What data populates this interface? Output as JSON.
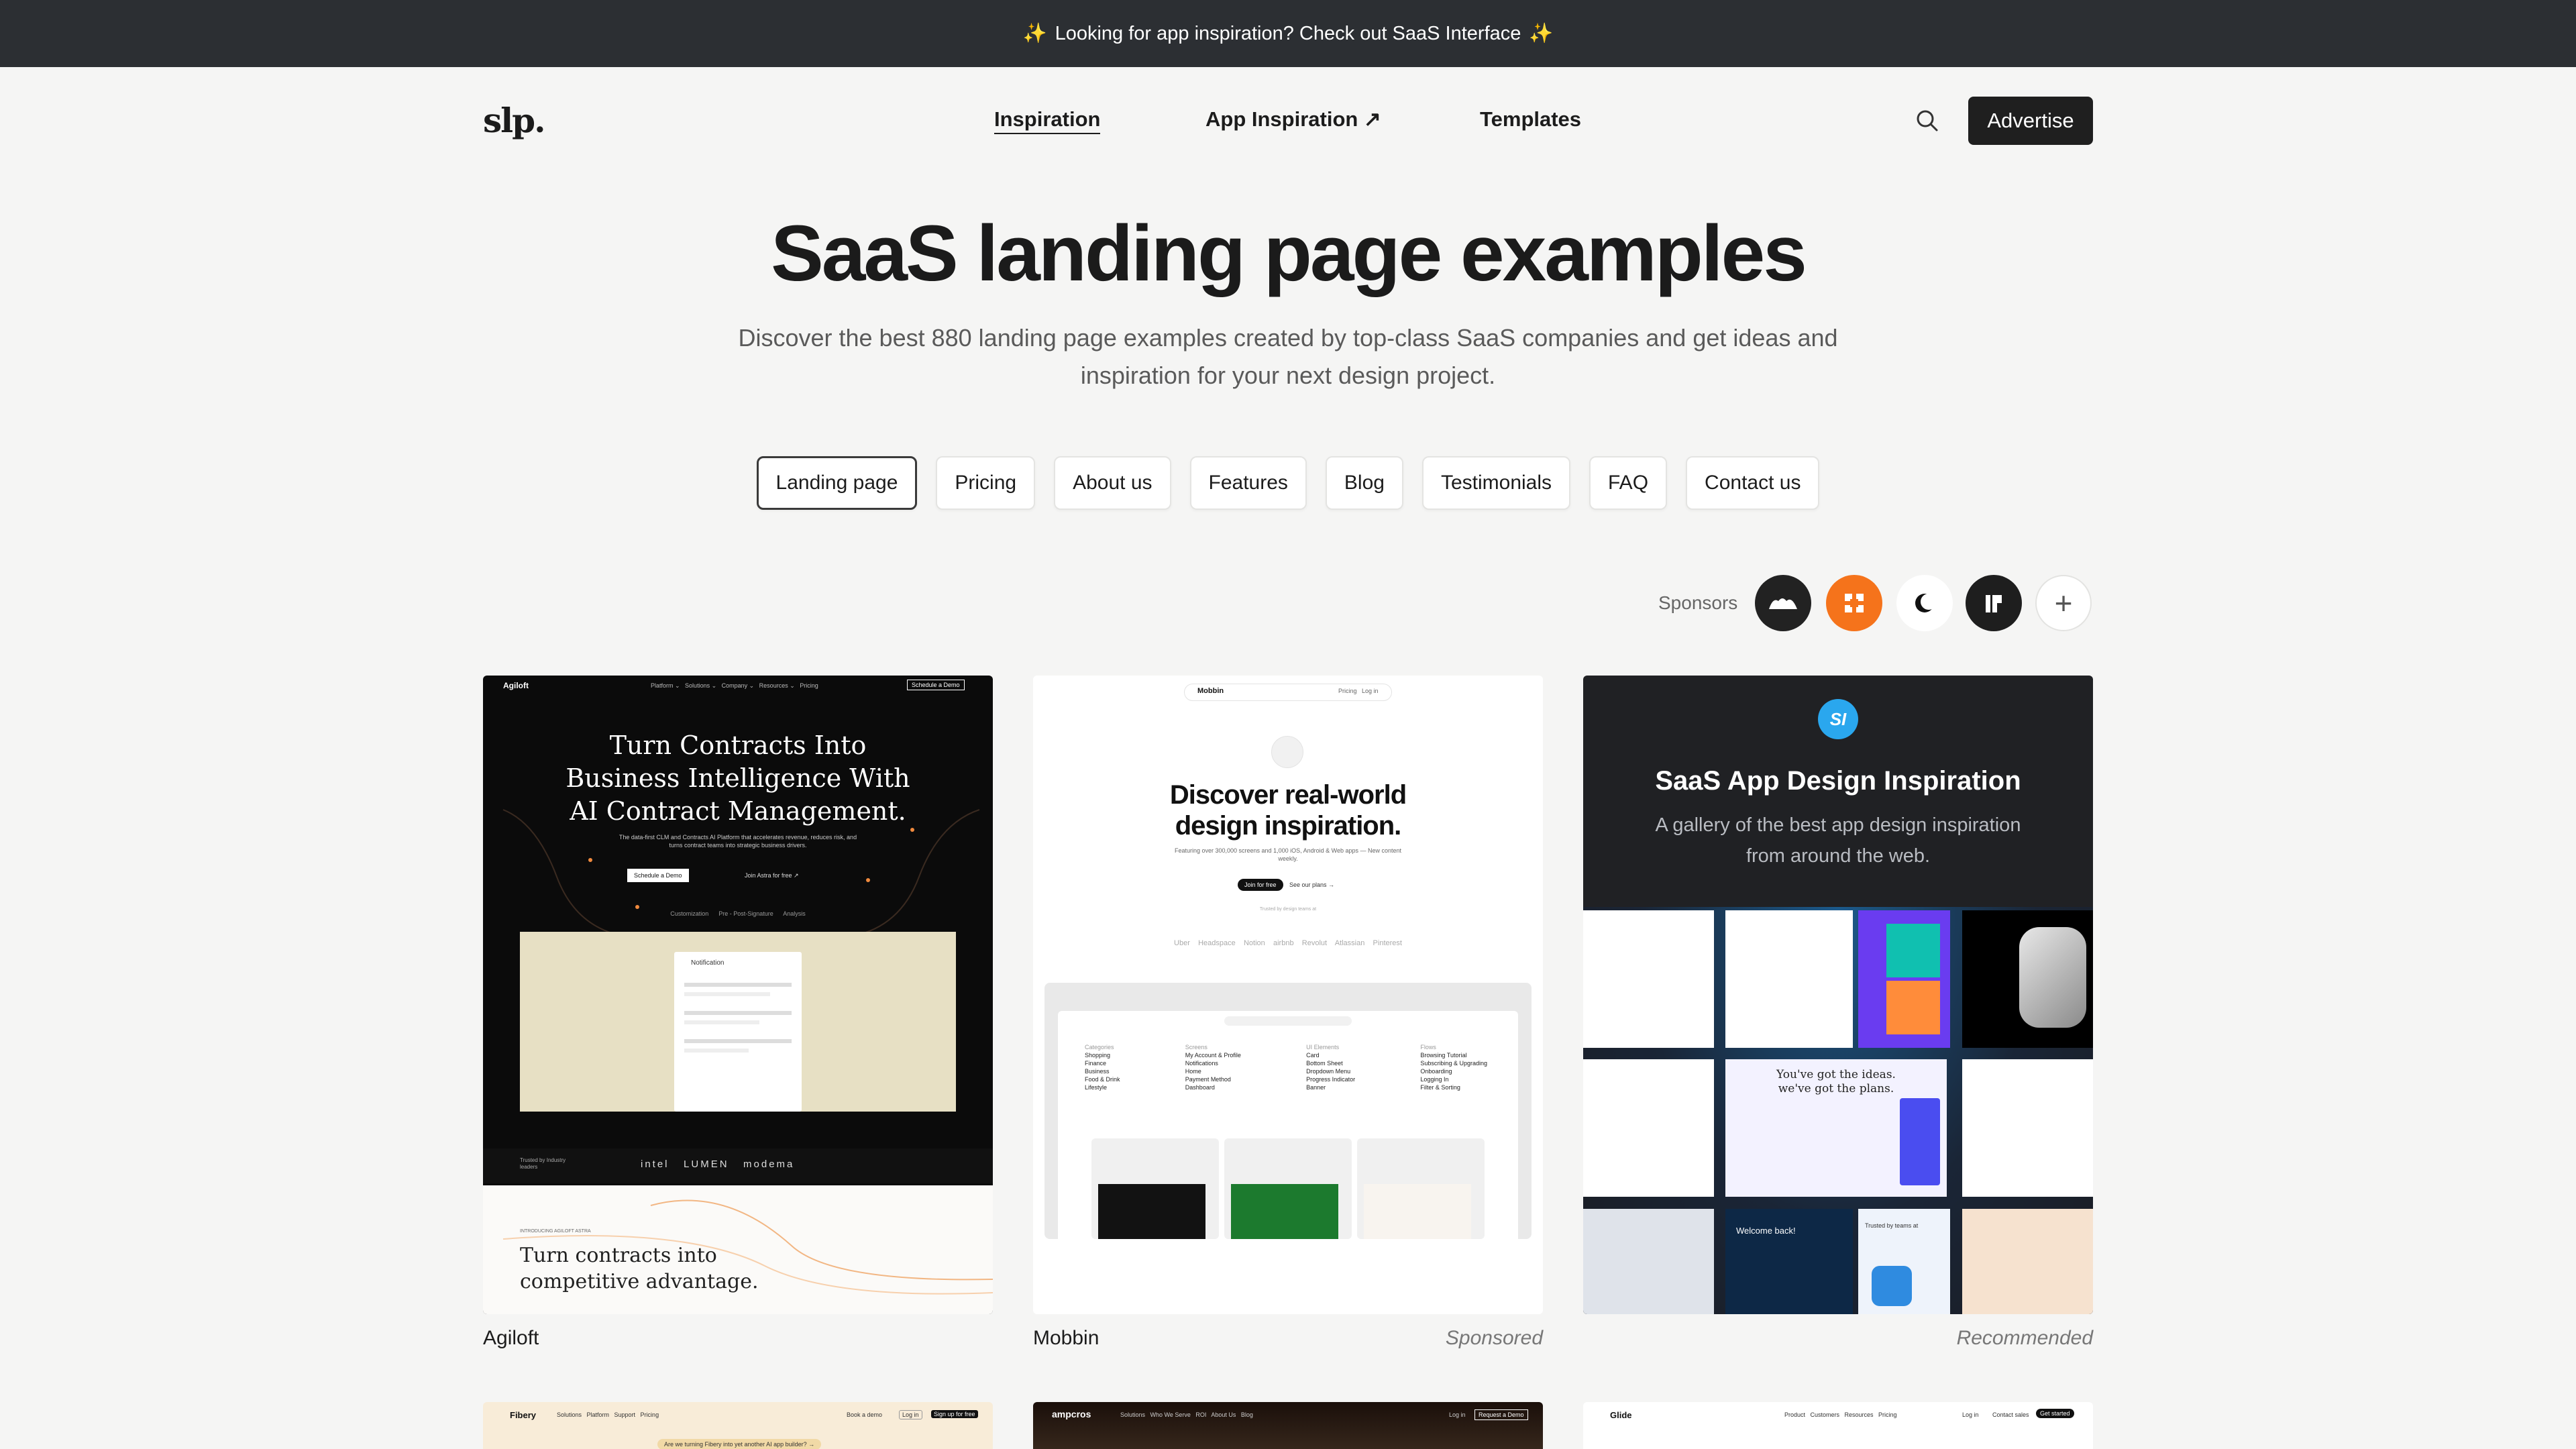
{
  "banner": {
    "text": "Looking for app inspiration? Check out SaaS Interface",
    "spark": "✨"
  },
  "header": {
    "logo": "slp.",
    "nav": [
      {
        "label": "Inspiration",
        "active": true
      },
      {
        "label": "App Inspiration ↗",
        "active": false
      },
      {
        "label": "Templates",
        "active": false
      }
    ],
    "search_icon": "search-icon",
    "advertise_label": "Advertise"
  },
  "hero": {
    "title": "SaaS landing page examples",
    "subtitle": "Discover the best 880 landing page examples created by top-class SaaS companies and get ideas and inspiration for your next design project."
  },
  "filters": [
    "Landing page",
    "Pricing",
    "About us",
    "Features",
    "Blog",
    "Testimonials",
    "FAQ",
    "Contact us"
  ],
  "active_filter": "Landing page",
  "sponsors": {
    "label": "Sponsors",
    "add_symbol": "+"
  },
  "cards": [
    {
      "name": "Agiloft",
      "tag": "",
      "preview": {
        "brand": "Agiloft",
        "nav": "Platform ⌄   Solutions ⌄   Company ⌄   Resources ⌄   Pricing",
        "cta": "Schedule a Demo",
        "headline_1": "Turn Contracts Into",
        "headline_2": "Business Intelligence With",
        "headline_3": "AI Contract Management.",
        "body": "The data-first CLM and Contracts AI Platform that accelerates revenue, reduces risk, and turns contract teams into strategic business drivers.",
        "btn_primary": "Schedule a Demo",
        "btn_secondary": "Join Astra for free ↗",
        "tabs": "Customization      Pre - Post-Signature      Analysis",
        "notif_title": "Notification",
        "logos": "intel   LUMEN   modema",
        "trusted": "Trusted by Industry leaders",
        "lower_kicker": "INTRODUCING AGILOFT ASTRA",
        "lower_1": "Turn contracts into",
        "lower_2": "competitive advantage."
      }
    },
    {
      "name": "Mobbin",
      "tag": "Sponsored",
      "preview": {
        "brand": "Mobbin",
        "nav": "Pricing   Log in",
        "headline_1": "Discover real-world",
        "headline_2": "design inspiration.",
        "body": "Featuring over 300,000 screens and 1,000 iOS, Android & Web apps — New content weekly.",
        "btn_primary": "Join for free",
        "btn_secondary": "See our plans →",
        "trusted": "Trusted by design teams at",
        "logos": "Uber    Headspace    Notion    airbnb    Revolut    Atlassian    Pinterest",
        "app_cols": [
          [
            "Categories",
            "Shopping",
            "Finance",
            "Business",
            "Food & Drink",
            "Lifestyle"
          ],
          [
            "Screens",
            "My Account & Profile",
            "Notifications",
            "Home",
            "Payment Method",
            "Dashboard"
          ],
          [
            "UI Elements",
            "Card",
            "Bottom Sheet",
            "Dropdown Menu",
            "Progress Indicator",
            "Banner"
          ],
          [
            "Flows",
            "Browsing Tutorial",
            "Subscribing & Upgrading",
            "Onboarding",
            "Logging In",
            "Filter & Sorting"
          ]
        ]
      }
    },
    {
      "name": "",
      "tag": "Recommended",
      "preview": {
        "badge": "SI",
        "title": "SaaS App Design Inspiration",
        "subtitle_1": "A gallery of the best app design inspiration",
        "subtitle_2": "from around the web.",
        "tile_1": "You've got the ideas.",
        "tile_2": "we've got the plans.",
        "tile_3": "Welcome back!",
        "tile_4": "Trusted by teams at"
      }
    }
  ],
  "bottom_cards": [
    {
      "brand": "Fibery",
      "nav": "Solutions   Platform   Support   Pricing",
      "cta_1": "Book a demo",
      "cta_2": "Log in",
      "cta_3": "Sign up for free",
      "notice": "Are we turning Fibery into yet another AI app builder? →"
    },
    {
      "brand": "ampcros",
      "nav": "Solutions   Who We Serve   ROI   About Us   Blog",
      "cta_1": "Log in",
      "cta_2": "Request a Demo"
    },
    {
      "brand": "Glide",
      "nav": "Product   Customers   Resources   Pricing",
      "cta_1": "Log in",
      "cta_2": "Contact sales",
      "cta_3": "Get started"
    }
  ],
  "colors": {
    "banner_bg": "#2c2f33",
    "page_bg": "#f5f5f4",
    "sponsor_orange": "#f5731b",
    "accent_blue": "#2aa7ee",
    "dark": "#1f1f1f"
  }
}
